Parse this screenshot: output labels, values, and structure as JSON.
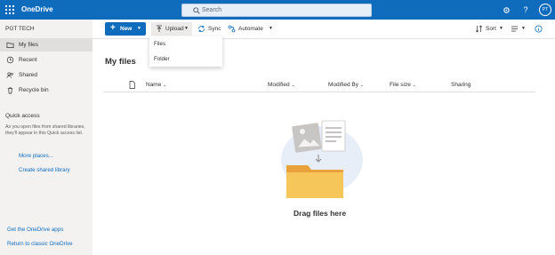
{
  "app": {
    "name": "OneDrive"
  },
  "search": {
    "placeholder": "Search"
  },
  "user": {
    "initials": "PT"
  },
  "sidebar": {
    "org": "PGT TECH",
    "items": [
      {
        "label": "My files",
        "icon": "folder-icon"
      },
      {
        "label": "Recent",
        "icon": "clock-icon"
      },
      {
        "label": "Shared",
        "icon": "people-icon"
      },
      {
        "label": "Recycle bin",
        "icon": "trash-icon"
      }
    ],
    "quick_access": {
      "title": "Quick access",
      "description": "As you open files from shared libraries, they'll appear in this Quick access list.",
      "more_places": "More places...",
      "create_library": "Create shared library"
    },
    "footer": {
      "get_apps": "Get the OneDrive apps",
      "classic": "Return to classic OneDrive"
    }
  },
  "toolbar": {
    "new_label": "New",
    "upload_label": "Upload",
    "sync_label": "Sync",
    "automate_label": "Automate",
    "sort_label": "Sort"
  },
  "upload_menu": {
    "files": "Files",
    "folder": "Folder"
  },
  "main": {
    "title": "My files",
    "columns": {
      "name": "Name",
      "modified": "Modified",
      "modified_by": "Modified By",
      "file_size": "File size",
      "sharing": "Sharing"
    },
    "empty_message": "Drag files here"
  },
  "colors": {
    "brand": "#0f6cbd",
    "sidebar": "#f3f2f1",
    "folder": "#f7c65b"
  }
}
